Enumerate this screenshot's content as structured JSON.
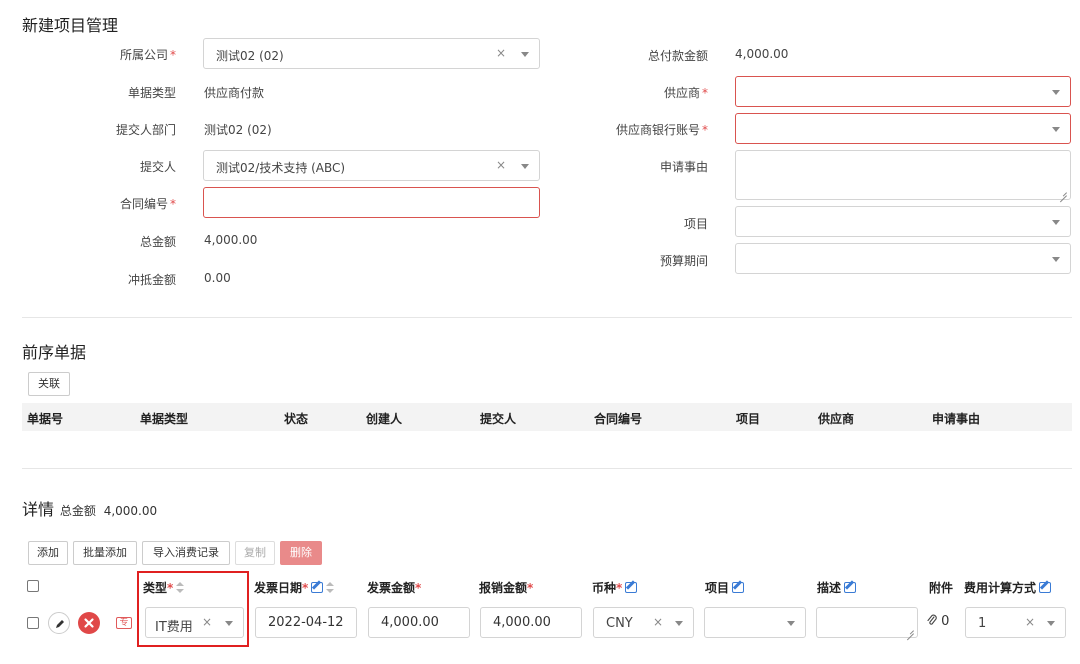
{
  "page_title": "新建项目管理",
  "form": {
    "company_label": "所属公司",
    "company_value": "测试02 (02)",
    "doc_type_label": "单据类型",
    "doc_type_value": "供应商付款",
    "dept_label": "提交人部门",
    "dept_value": "测试02 (02)",
    "submitter_label": "提交人",
    "submitter_value": "测试02/技术支持 (ABC)",
    "contract_label": "合同编号",
    "contract_value": "",
    "total_label": "总金额",
    "total_value": "4,000.00",
    "offset_label": "冲抵金额",
    "offset_value": "0.00",
    "pay_total_label": "总付款金额",
    "pay_total_value": "4,000.00",
    "supplier_label": "供应商",
    "supplier_value": "",
    "bank_label": "供应商银行账号",
    "bank_value": "",
    "reason_label": "申请事由",
    "reason_value": "",
    "project_label": "项目",
    "project_value": "",
    "budget_label": "预算期间",
    "budget_value": ""
  },
  "prev_docs": {
    "title": "前序单据",
    "link_button": "关联",
    "columns": [
      "单据号",
      "单据类型",
      "状态",
      "创建人",
      "提交人",
      "合同编号",
      "项目",
      "供应商",
      "申请事由"
    ]
  },
  "details": {
    "title": "详情",
    "total_label": "总金额",
    "total_value": "4,000.00",
    "buttons": [
      "添加",
      "批量添加",
      "导入消费记录",
      "复制",
      "删除"
    ],
    "columns": [
      "类型",
      "发票日期",
      "发票金额",
      "报销金额",
      "币种",
      "项目",
      "描述",
      "附件",
      "费用计算方式"
    ],
    "row": {
      "type": "IT费用",
      "invoice_date": "2022-04-12",
      "invoice_amount": "4,000.00",
      "reimburse_amount": "4,000.00",
      "currency": "CNY",
      "project": "",
      "description": "",
      "attachment_count": "0",
      "calc_method": "1",
      "stamp": "专"
    }
  },
  "colors": {
    "required_star": "#e14b4b",
    "error_border": "#d9534f",
    "edit_icon": "#3a7bd5",
    "delete_button": "#e98a8a",
    "highlight_box": "#e02020"
  },
  "clear_glyph": "×"
}
